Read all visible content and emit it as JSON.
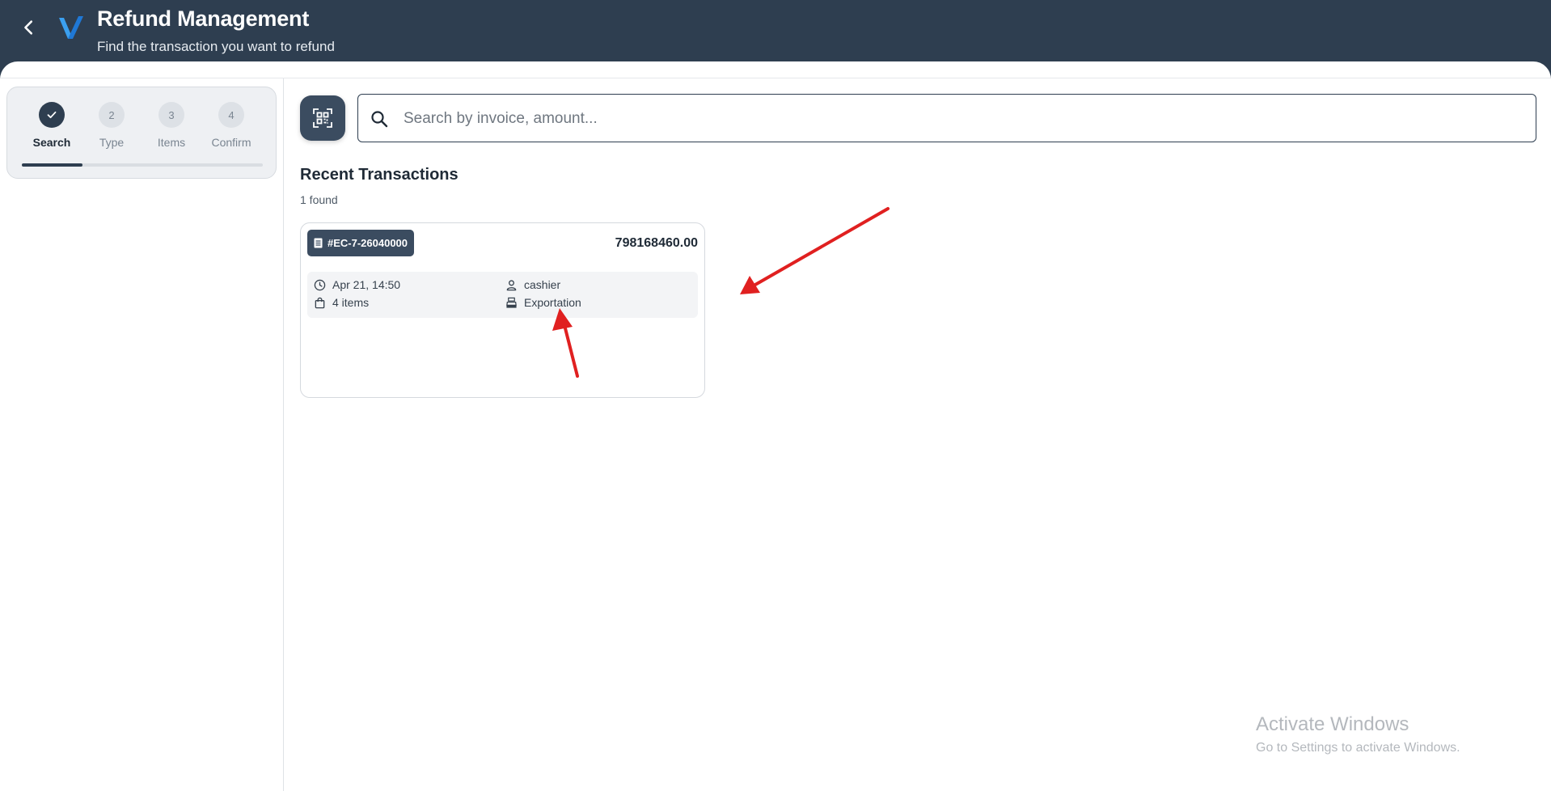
{
  "header": {
    "title": "Refund Management",
    "subtitle": "Find the transaction you want to refund",
    "back_icon": "chevron-left-icon",
    "logo_icon": "v-logo-icon",
    "background_color": "#2e3e50"
  },
  "stepper": {
    "steps": [
      {
        "number": "1",
        "label": "Search",
        "state": "done"
      },
      {
        "number": "2",
        "label": "Type",
        "state": "pending"
      },
      {
        "number": "3",
        "label": "Items",
        "state": "pending"
      },
      {
        "number": "4",
        "label": "Confirm",
        "state": "pending"
      }
    ],
    "progress_fraction": 0.25
  },
  "search": {
    "placeholder": "Search by invoice, amount...",
    "value": "",
    "scan_icon": "qr-scan-icon"
  },
  "transactions": {
    "heading": "Recent Transactions",
    "count_text": "1 found",
    "items": [
      {
        "invoice": "#EC-7-26040000",
        "amount": "798168460.00",
        "datetime": "Apr 21, 14:50",
        "user": "cashier",
        "items_count": "4 items",
        "register": "Exportation"
      }
    ]
  },
  "annotations": {
    "arrow_color": "#e02020"
  },
  "watermark": {
    "title": "Activate Windows",
    "subtitle": "Go to Settings to activate Windows."
  }
}
